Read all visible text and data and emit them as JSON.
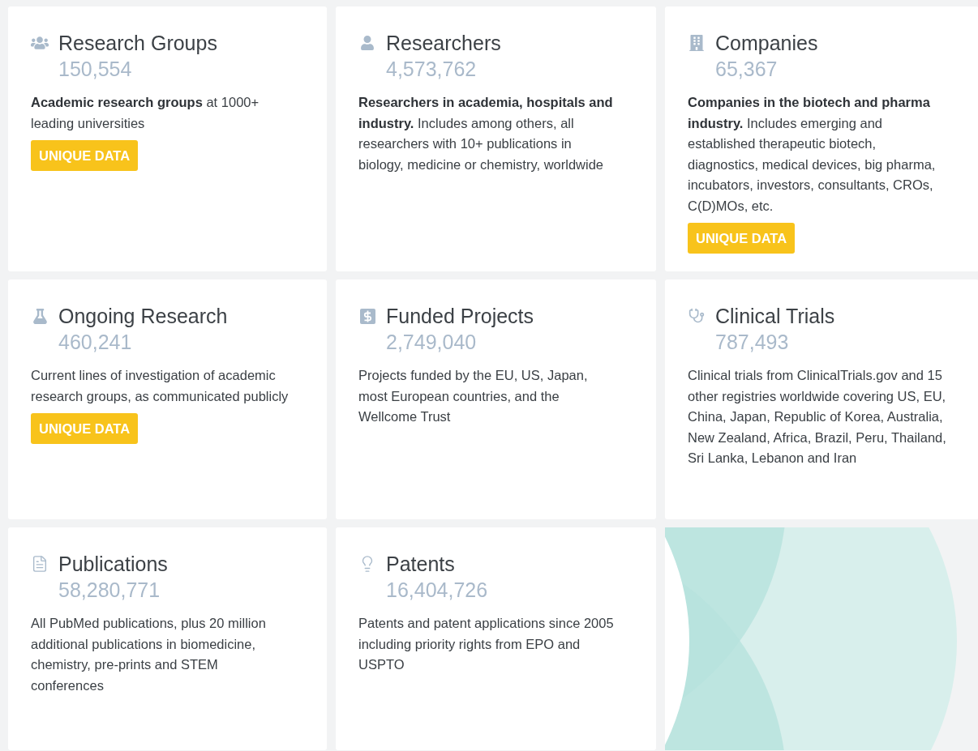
{
  "cards": [
    {
      "title": "Research Groups",
      "count": "150,554",
      "description": "**Academic research groups** at 1000+ leading universities",
      "badge": "UNIQUE DATA"
    },
    {
      "title": "Researchers",
      "count": "4,573,762",
      "description": "**Researchers in academia, hospitals and industry.** Includes among others, all researchers with 10+ publications in biology, medicine or chemistry, worldwide"
    },
    {
      "title": "Companies",
      "count": "65,367",
      "description": "**Companies in the biotech and pharma industry.** Includes emerging and established therapeutic biotech, diagnostics, medical devices, big pharma, incubators, investors, consultants, CROs, C(D)MOs, etc.",
      "badge": "UNIQUE DATA"
    },
    {
      "title": "Ongoing Research",
      "count": "460,241",
      "description": "Current lines of investigation of academic research groups, as communicated publicly",
      "badge": "UNIQUE DATA"
    },
    {
      "title": "Funded Projects",
      "count": "2,749,040",
      "description": "Projects funded by the EU, US, Japan, most European countries, and the Wellcome Trust"
    },
    {
      "title": "Clinical Trials",
      "count": "787,493",
      "description": "Clinical trials from ClinicalTrials.gov and 15 other registries worldwide covering US, EU, China, Japan, Republic of Korea, Australia, New Zealand, Africa, Brazil, Peru, Thailand, Sri Lanka, Lebanon and Iran"
    },
    {
      "title": "Publications",
      "count": "58,280,771",
      "description": "All PubMed publications, plus 20 million additional publications in biomedicine, chemistry, pre-prints and STEM conferences"
    },
    {
      "title": "Patents",
      "count": "16,404,726",
      "description": "Patents and patent applications since 2005 including priority rights from EPO and USPTO"
    }
  ]
}
